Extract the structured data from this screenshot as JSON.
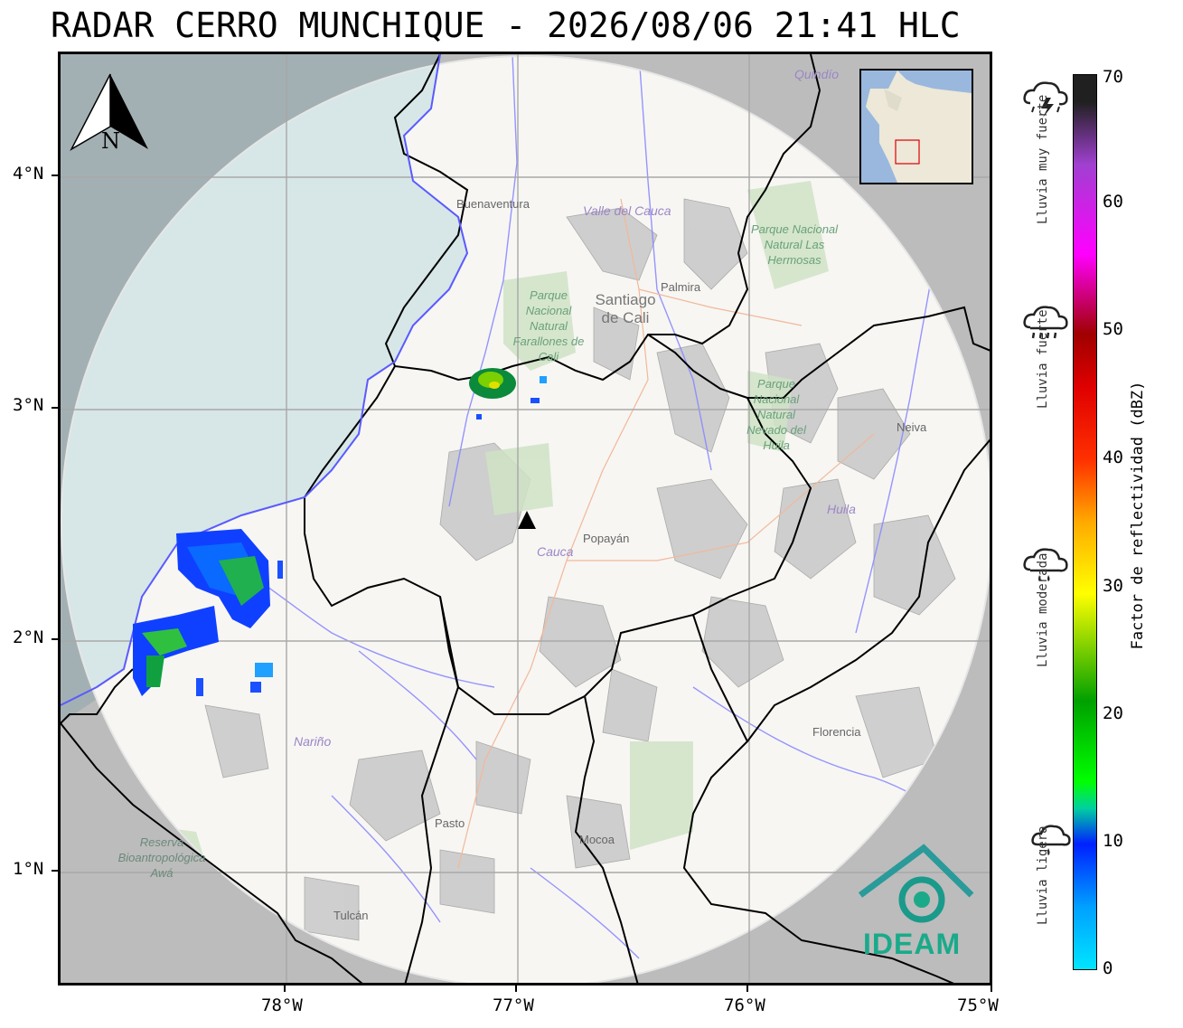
{
  "title": "RADAR CERRO MUNCHIQUE - 2026/08/06 21:41 HLC",
  "map": {
    "lat_labels": [
      "4°N",
      "3°N",
      "2°N",
      "1°N"
    ],
    "lon_labels": [
      "78°W",
      "77°W",
      "76°W",
      "75°W"
    ],
    "place_labels": {
      "buenaventura": "Buenaventura",
      "valle": "Valle del Cauca",
      "palmira": "Palmira",
      "cali": "Santiago de Cali",
      "farallones": "Parque Nacional Natural Farallones de Cali",
      "hermosas": "Parque Nacional Natural Las Hermosas",
      "quindio": "Quindío",
      "nevado": "Parque Nacional Natural Nevado del Huila",
      "neiva": "Neiva",
      "huila": "Huila",
      "cauca": "Cauca",
      "popayan": "Popayán",
      "narino": "Nariño",
      "florencia": "Florencia",
      "pasto": "Pasto",
      "mocoa": "Mocoa",
      "tulcan": "Tulcán",
      "awa": "Reserva Bioantropológica Awá"
    },
    "north_label": "N",
    "logo_text": "IDEAM",
    "radar_site_icon": "triangle-marker-icon",
    "colors": {
      "ocean": "#aad3df",
      "land": "#f2efe9",
      "range_mask": "#ffffff",
      "outside_range": "#9a9a9a",
      "borders": "#000000",
      "rivers": "#7a7aff",
      "logo": "#1a9a8a"
    }
  },
  "colorbar": {
    "label": "Factor de reflectividad (dBZ)",
    "ticks": [
      "70",
      "60",
      "50",
      "40",
      "30",
      "20",
      "10",
      "0"
    ],
    "rain_classes": [
      {
        "text": "Lluvia muy fuerte",
        "icon": "storm-cloud-icon"
      },
      {
        "text": "Lluvia fuerte",
        "icon": "heavy-rain-cloud-icon"
      },
      {
        "text": "Lluvia moderada",
        "icon": "rain-cloud-icon"
      },
      {
        "text": "Lluvia ligera",
        "icon": "light-rain-cloud-icon"
      }
    ]
  }
}
